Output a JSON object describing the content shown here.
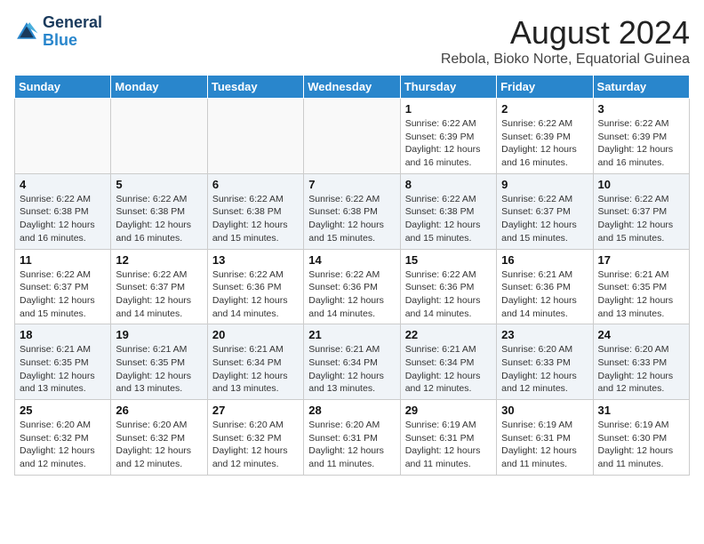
{
  "header": {
    "logo_line1": "General",
    "logo_line2": "Blue",
    "main_title": "August 2024",
    "subtitle": "Rebola, Bioko Norte, Equatorial Guinea"
  },
  "calendar": {
    "days_of_week": [
      "Sunday",
      "Monday",
      "Tuesday",
      "Wednesday",
      "Thursday",
      "Friday",
      "Saturday"
    ],
    "weeks": [
      {
        "shaded": false,
        "days": [
          {
            "num": "",
            "info": ""
          },
          {
            "num": "",
            "info": ""
          },
          {
            "num": "",
            "info": ""
          },
          {
            "num": "",
            "info": ""
          },
          {
            "num": "1",
            "info": "Sunrise: 6:22 AM\nSunset: 6:39 PM\nDaylight: 12 hours\nand 16 minutes."
          },
          {
            "num": "2",
            "info": "Sunrise: 6:22 AM\nSunset: 6:39 PM\nDaylight: 12 hours\nand 16 minutes."
          },
          {
            "num": "3",
            "info": "Sunrise: 6:22 AM\nSunset: 6:39 PM\nDaylight: 12 hours\nand 16 minutes."
          }
        ]
      },
      {
        "shaded": true,
        "days": [
          {
            "num": "4",
            "info": "Sunrise: 6:22 AM\nSunset: 6:38 PM\nDaylight: 12 hours\nand 16 minutes."
          },
          {
            "num": "5",
            "info": "Sunrise: 6:22 AM\nSunset: 6:38 PM\nDaylight: 12 hours\nand 16 minutes."
          },
          {
            "num": "6",
            "info": "Sunrise: 6:22 AM\nSunset: 6:38 PM\nDaylight: 12 hours\nand 15 minutes."
          },
          {
            "num": "7",
            "info": "Sunrise: 6:22 AM\nSunset: 6:38 PM\nDaylight: 12 hours\nand 15 minutes."
          },
          {
            "num": "8",
            "info": "Sunrise: 6:22 AM\nSunset: 6:38 PM\nDaylight: 12 hours\nand 15 minutes."
          },
          {
            "num": "9",
            "info": "Sunrise: 6:22 AM\nSunset: 6:37 PM\nDaylight: 12 hours\nand 15 minutes."
          },
          {
            "num": "10",
            "info": "Sunrise: 6:22 AM\nSunset: 6:37 PM\nDaylight: 12 hours\nand 15 minutes."
          }
        ]
      },
      {
        "shaded": false,
        "days": [
          {
            "num": "11",
            "info": "Sunrise: 6:22 AM\nSunset: 6:37 PM\nDaylight: 12 hours\nand 15 minutes."
          },
          {
            "num": "12",
            "info": "Sunrise: 6:22 AM\nSunset: 6:37 PM\nDaylight: 12 hours\nand 14 minutes."
          },
          {
            "num": "13",
            "info": "Sunrise: 6:22 AM\nSunset: 6:36 PM\nDaylight: 12 hours\nand 14 minutes."
          },
          {
            "num": "14",
            "info": "Sunrise: 6:22 AM\nSunset: 6:36 PM\nDaylight: 12 hours\nand 14 minutes."
          },
          {
            "num": "15",
            "info": "Sunrise: 6:22 AM\nSunset: 6:36 PM\nDaylight: 12 hours\nand 14 minutes."
          },
          {
            "num": "16",
            "info": "Sunrise: 6:21 AM\nSunset: 6:36 PM\nDaylight: 12 hours\nand 14 minutes."
          },
          {
            "num": "17",
            "info": "Sunrise: 6:21 AM\nSunset: 6:35 PM\nDaylight: 12 hours\nand 13 minutes."
          }
        ]
      },
      {
        "shaded": true,
        "days": [
          {
            "num": "18",
            "info": "Sunrise: 6:21 AM\nSunset: 6:35 PM\nDaylight: 12 hours\nand 13 minutes."
          },
          {
            "num": "19",
            "info": "Sunrise: 6:21 AM\nSunset: 6:35 PM\nDaylight: 12 hours\nand 13 minutes."
          },
          {
            "num": "20",
            "info": "Sunrise: 6:21 AM\nSunset: 6:34 PM\nDaylight: 12 hours\nand 13 minutes."
          },
          {
            "num": "21",
            "info": "Sunrise: 6:21 AM\nSunset: 6:34 PM\nDaylight: 12 hours\nand 13 minutes."
          },
          {
            "num": "22",
            "info": "Sunrise: 6:21 AM\nSunset: 6:34 PM\nDaylight: 12 hours\nand 12 minutes."
          },
          {
            "num": "23",
            "info": "Sunrise: 6:20 AM\nSunset: 6:33 PM\nDaylight: 12 hours\nand 12 minutes."
          },
          {
            "num": "24",
            "info": "Sunrise: 6:20 AM\nSunset: 6:33 PM\nDaylight: 12 hours\nand 12 minutes."
          }
        ]
      },
      {
        "shaded": false,
        "days": [
          {
            "num": "25",
            "info": "Sunrise: 6:20 AM\nSunset: 6:32 PM\nDaylight: 12 hours\nand 12 minutes."
          },
          {
            "num": "26",
            "info": "Sunrise: 6:20 AM\nSunset: 6:32 PM\nDaylight: 12 hours\nand 12 minutes."
          },
          {
            "num": "27",
            "info": "Sunrise: 6:20 AM\nSunset: 6:32 PM\nDaylight: 12 hours\nand 12 minutes."
          },
          {
            "num": "28",
            "info": "Sunrise: 6:20 AM\nSunset: 6:31 PM\nDaylight: 12 hours\nand 11 minutes."
          },
          {
            "num": "29",
            "info": "Sunrise: 6:19 AM\nSunset: 6:31 PM\nDaylight: 12 hours\nand 11 minutes."
          },
          {
            "num": "30",
            "info": "Sunrise: 6:19 AM\nSunset: 6:31 PM\nDaylight: 12 hours\nand 11 minutes."
          },
          {
            "num": "31",
            "info": "Sunrise: 6:19 AM\nSunset: 6:30 PM\nDaylight: 12 hours\nand 11 minutes."
          }
        ]
      }
    ]
  }
}
